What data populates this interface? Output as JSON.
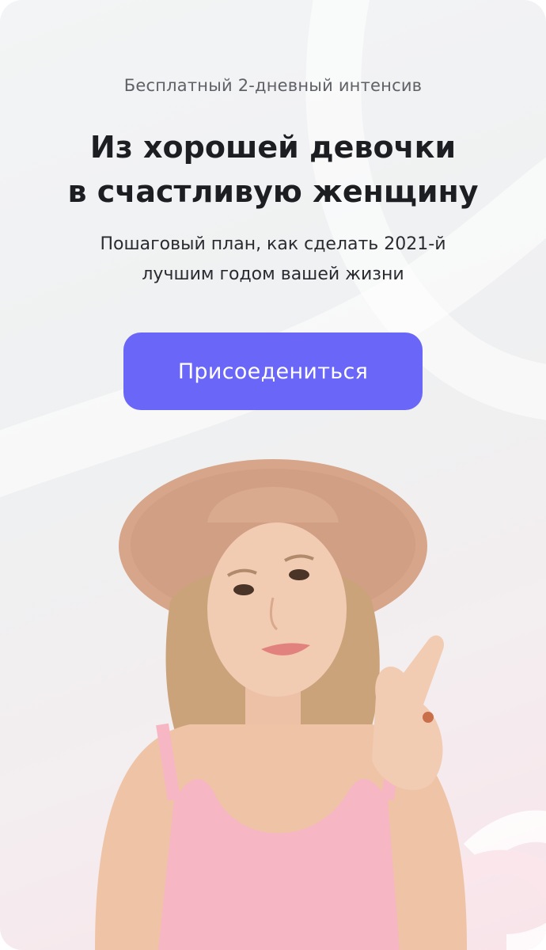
{
  "promo": {
    "subtitle": "Бесплатный 2-дневный интенсив",
    "title_line1": "Из хорошей девочки",
    "title_line2": "в счастливую женщину",
    "description_line1": "Пошаговый план, как сделать 2021-й",
    "description_line2": "лучшим годом вашей жизни",
    "cta_label": "Присоедениться"
  },
  "colors": {
    "accent": "#6a66f7",
    "title": "#1d1e22",
    "subtitle": "#5f6166",
    "background": "#eff0f1"
  }
}
